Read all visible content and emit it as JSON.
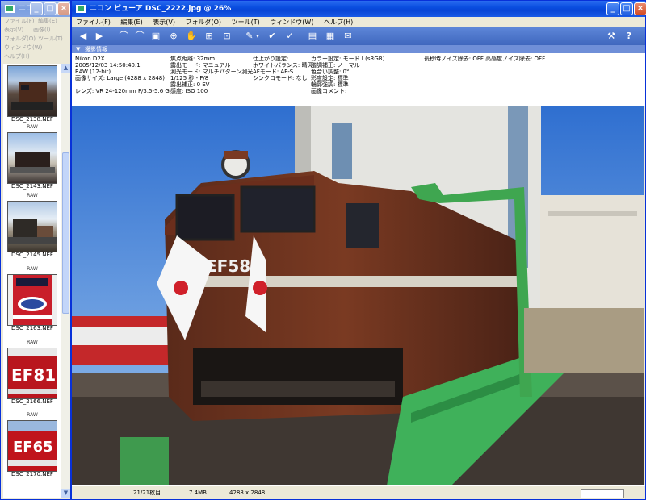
{
  "left_window": {
    "title": "ニコン ビュ",
    "menu": [
      "ファイル(F)",
      "編集(E)",
      "表示(V)",
      "画像(I)",
      "フォルダ(O)",
      "ツール(T)",
      "ウィンドウ(W)",
      "ヘルプ(H)"
    ],
    "thumbnails": [
      {
        "filename": "DSC_2138.NEF",
        "raw_label": "RAW"
      },
      {
        "filename": "DSC_2143.NEF",
        "raw_label": "RAW"
      },
      {
        "filename": "DSC_2145.NEF",
        "raw_label": "RAW"
      },
      {
        "filename": "DSC_2163.NEF",
        "raw_label": "RAW"
      },
      {
        "filename": "DSC_2166.NEF",
        "raw_label": "RAW"
      },
      {
        "filename": "DSC_2170.NEF",
        "raw_label": "RAW"
      }
    ]
  },
  "main_window": {
    "title": "ニコン ビューア DSC_2222.jpg @ 26%",
    "menu": [
      "ファイル(F)",
      "編集(E)",
      "表示(V)",
      "フォルダ(O)",
      "ツール(T)",
      "ウィンドウ(W)",
      "ヘルプ(H)"
    ],
    "info_header": "撮影情報",
    "info": {
      "col1": [
        "Nikon D2X",
        "2005/12/03 14:50:40.1",
        "RAW (12-bit)",
        "画像サイズ: Large (4288 x 2848)",
        "",
        "レンズ: VR 24-120mm F/3.5-5.6 G"
      ],
      "col2": [
        "焦点距離: 32mm",
        "露出モード: マニュアル",
        "測光モード: マルチパターン測光",
        "1/125 秒 - F/8",
        "露出補正: 0 EV",
        "感度: ISO 100"
      ],
      "col3": [
        "仕上がり設定:",
        "ホワイトバランス: 晴天",
        "AFモード: AF-S",
        "シンクロモード: なし"
      ],
      "col4": [
        "カラー設定: モード I (sRGB)",
        "階調補正: ノーマル",
        "色合い調整: 0°",
        "彩度設定: 標準",
        "輪郭強調: 標準",
        "画像コメント:"
      ],
      "col5": [
        "長秒時ノイズ除去: OFF   高感度ノイズ除去: OFF"
      ]
    },
    "loco_number": "EF58",
    "status": {
      "count": "21/21枚目",
      "size": "7.4MB",
      "dimensions": "4288 x 2848"
    }
  }
}
